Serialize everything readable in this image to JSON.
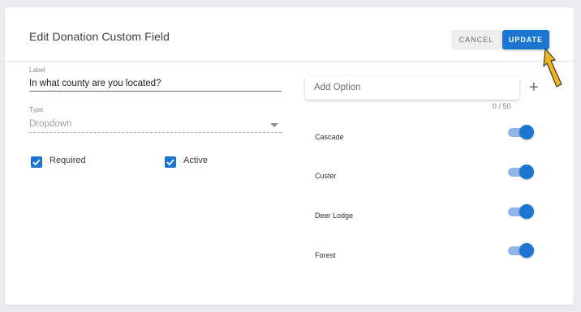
{
  "dialog": {
    "title": "Edit Donation Custom Field",
    "cancel_label": "CANCEL",
    "update_label": "UPDATE"
  },
  "form": {
    "label_caption": "Label",
    "label_value": "In what county are you located?",
    "type_caption": "Type",
    "type_value": "Dropdown",
    "required_label": "Required",
    "required_checked": true,
    "active_label": "Active",
    "active_checked": true
  },
  "options_panel": {
    "add_placeholder": "Add Option",
    "counter": "0 / 50",
    "options": [
      {
        "label": "Cascade",
        "enabled": true
      },
      {
        "label": "Custer",
        "enabled": true
      },
      {
        "label": "Deer Lodge",
        "enabled": true
      },
      {
        "label": "Forest",
        "enabled": true
      }
    ]
  },
  "colors": {
    "accent": "#1b76d2",
    "toggle_track": "#8fb6e6",
    "pointer_arrow": "#f5b41a"
  }
}
